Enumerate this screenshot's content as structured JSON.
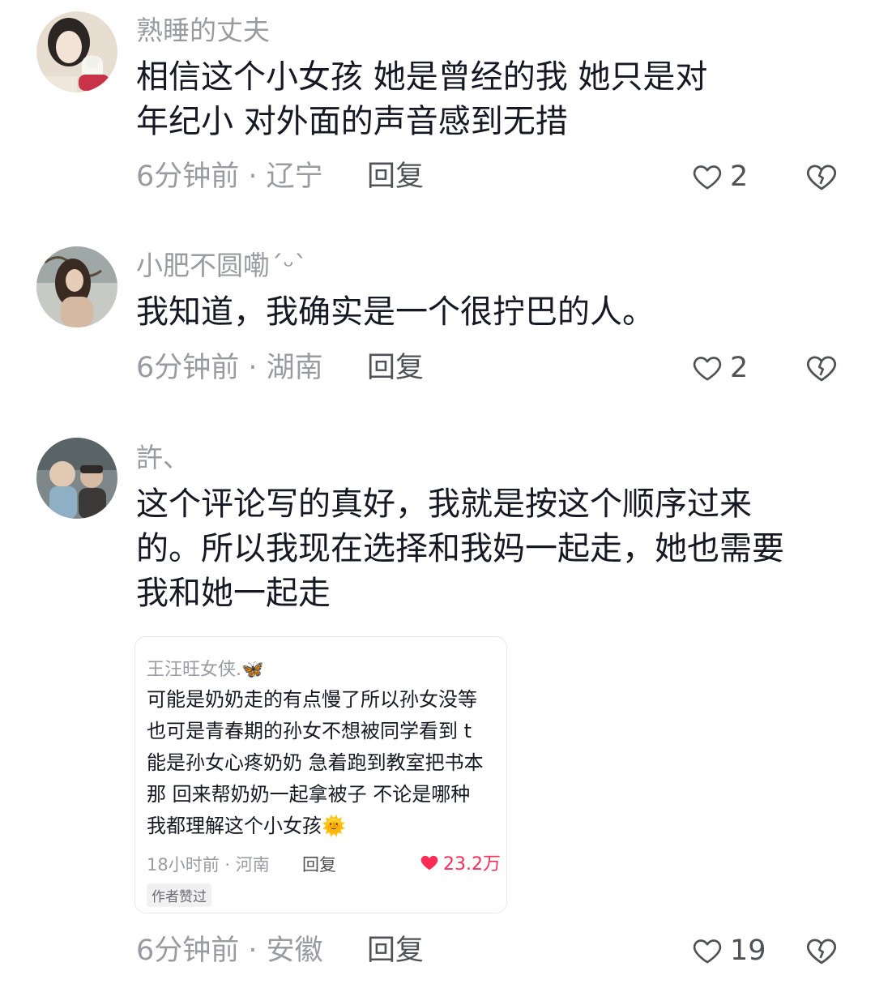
{
  "comments": [
    {
      "username": "熟睡的丈夫",
      "lines": [
        "相信这个小女孩 她是曾经的我 她只是对",
        "年纪小 对外面的声音感到无措"
      ],
      "meta": "6分钟前 · 辽宁",
      "reply": "回复",
      "likes": "2",
      "avatar_color": "#d9c7b5"
    },
    {
      "username": "小肥不圆嘞ˊᵕˋ",
      "lines": [
        "我知道，我确实是一个很拧巴的人。"
      ],
      "meta": "6分钟前 · 湖南",
      "reply": "回复",
      "likes": "2",
      "avatar_color": "#8d7b6a"
    },
    {
      "username": "許、",
      "lines": [
        "这个评论写的真好，我就是按这个顺序过来",
        "的。所以我现在选择和我妈一起走，她也需要",
        "我和她一起走"
      ],
      "meta": "6分钟前 · 安徽",
      "reply": "回复",
      "likes": "19",
      "avatar_color": "#6f7a7f"
    }
  ],
  "embedded_card": {
    "username": "王汪旺女侠.🦋",
    "lines": [
      "可能是奶奶走的有点慢了所以孙女没等",
      "也可是青春期的孙女不想被同学看到 t",
      "能是孙女心疼奶奶 急着跑到教室把书本",
      "那 回来帮奶奶一起拿被子 不论是哪种",
      "我都理解这个小女孩🌞"
    ],
    "meta": "18小时前 · 河南",
    "reply": "回复",
    "likes": "23.2万",
    "badge": "作者赞过",
    "like_color": "#fe2c55"
  },
  "colors": {
    "text": "#161823",
    "muted": "#9a9ba1",
    "action": "#505258"
  }
}
